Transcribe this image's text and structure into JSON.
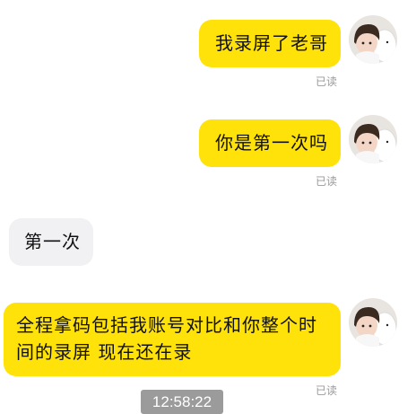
{
  "messages": [
    {
      "text": "我录屏了老哥",
      "status": "已读"
    },
    {
      "text": "你是第一次吗",
      "status": "已读"
    },
    {
      "text": "第一次"
    },
    {
      "text": "全程拿码包括我账号对比和你整个时间的录屏 现在还在录",
      "status": "已读"
    }
  ],
  "timestamp": "12:58:22",
  "avatar_icon": "avatar-girl-with-plush-icon"
}
